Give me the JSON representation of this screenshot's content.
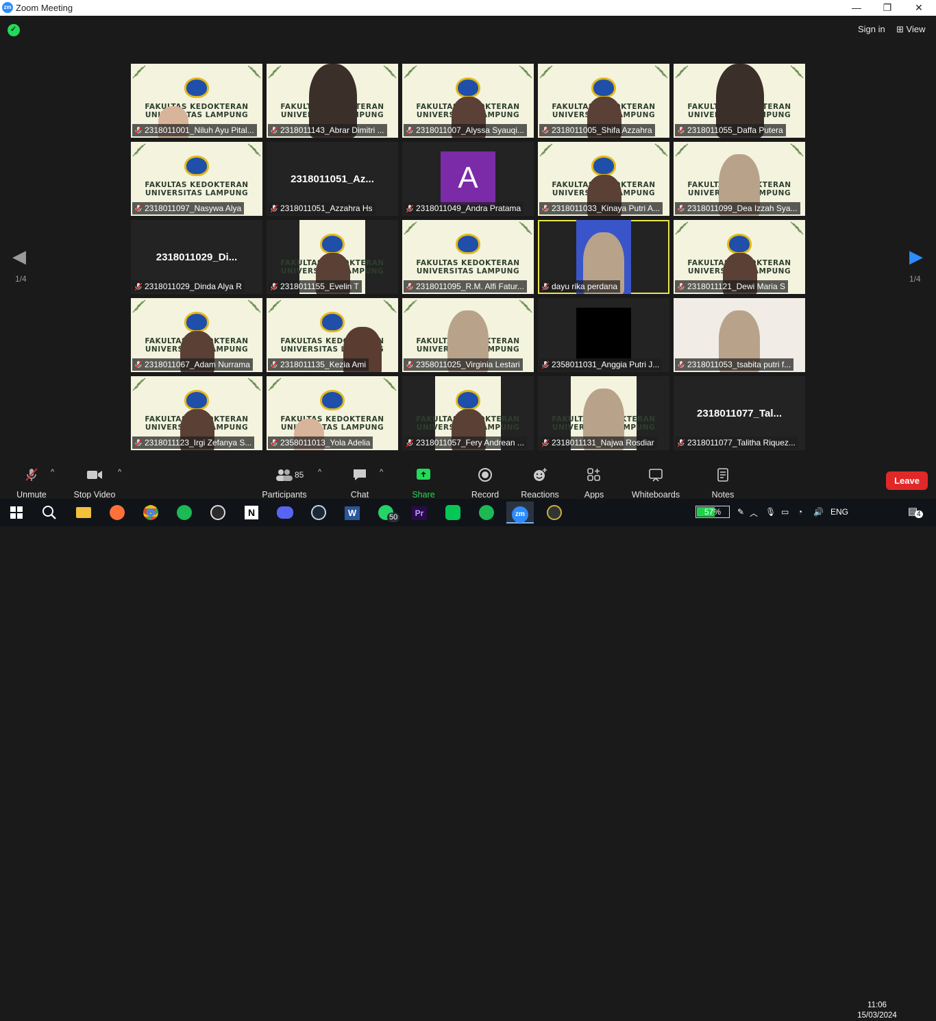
{
  "window": {
    "title": "Zoom Meeting",
    "minimize": "—",
    "restore": "❐",
    "close": "✕"
  },
  "topbar": {
    "sign_in": "Sign in",
    "view": "View",
    "view_icon": "grid-icon"
  },
  "pager": {
    "left": "1/4",
    "right": "1/4"
  },
  "tiles": [
    {
      "name": "2318011001_Niluh Ayu Pital...",
      "kind": "banner",
      "person": "left"
    },
    {
      "name": "2318011143_Abrar Dimitri ...",
      "kind": "banner",
      "person": "center-large"
    },
    {
      "name": "2318011007_Alyssa Syauqi...",
      "kind": "banner",
      "person": "center-small"
    },
    {
      "name": "2318011005_Shifa Azzahra",
      "kind": "banner",
      "person": "center-small"
    },
    {
      "name": "2318011055_Daffa Putera",
      "kind": "banner",
      "person": "center-large"
    },
    {
      "name": "2318011097_Nasywa Alya",
      "kind": "banner",
      "person": "none"
    },
    {
      "name": "2318011051_Azzahra Hs",
      "kind": "name",
      "big": "2318011051_Az..."
    },
    {
      "name": "2318011049_Andra Pratama",
      "kind": "avatar",
      "initial": "A"
    },
    {
      "name": "2318011033_Kinaya Putri A...",
      "kind": "banner",
      "person": "center-small"
    },
    {
      "name": "2318011099_Dea Izzah Sya...",
      "kind": "banner",
      "person": "center-hijab"
    },
    {
      "name": "2318011029_Dinda Alya R",
      "kind": "name",
      "big": "2318011029_Di..."
    },
    {
      "name": "2318011155_Evelin T",
      "kind": "banner-narrow",
      "person": "center-small"
    },
    {
      "name": "2318011095_R.M. Alfi Fatur...",
      "kind": "banner",
      "person": "none"
    },
    {
      "name": "dayu rika perdana",
      "kind": "video-narrow",
      "person": "center-hijab",
      "active": true
    },
    {
      "name": "2318011121_Dewi Maria S",
      "kind": "banner",
      "person": "center-small"
    },
    {
      "name": "2318011067_Adam Nurrama",
      "kind": "banner",
      "person": "center-small"
    },
    {
      "name": "2318011135_Kezia Ami",
      "kind": "banner",
      "person": "right"
    },
    {
      "name": "2358011025_Virginia Lestari",
      "kind": "banner",
      "person": "center-hijab"
    },
    {
      "name": "2358011031_Anggia Putri J...",
      "kind": "black"
    },
    {
      "name": "2318011053_tsabita putri f...",
      "kind": "video",
      "person": "center-hijab"
    },
    {
      "name": "2318011123_Irgi Zefanya S...",
      "kind": "banner",
      "person": "center-small"
    },
    {
      "name": "2358011013_Yola Adelia",
      "kind": "banner",
      "person": "left"
    },
    {
      "name": "2318011057_Fery Andrean ...",
      "kind": "banner-narrow",
      "person": "center-small"
    },
    {
      "name": "2318011131_Najwa Rosdiar",
      "kind": "banner-narrow",
      "person": "center-hijab"
    },
    {
      "name": "2318011077_Talitha Riquez...",
      "kind": "name",
      "big": "2318011077_Tal..."
    }
  ],
  "banner": {
    "line1": "FAKULTAS KEDOKTERAN",
    "line2": "UNIVERSITAS LAMPUNG"
  },
  "toolbar": {
    "unmute": "Unmute",
    "stop_video": "Stop Video",
    "participants": "Participants",
    "participants_count": "85",
    "chat": "Chat",
    "share_screen": "Share Screen",
    "record": "Record",
    "reactions": "Reactions",
    "apps": "Apps",
    "whiteboards": "Whiteboards",
    "notes": "Notes",
    "leave": "Leave"
  },
  "taskbar": {
    "whatsapp_badge": "50",
    "battery": "57%",
    "battery_level": 0.57,
    "lang": "ENG",
    "time": "11:06",
    "date": "15/03/2024",
    "notifications": "4"
  },
  "colors": {
    "accent_green": "#23d959",
    "leave_red": "#e02828",
    "active_border": "#e9e64a",
    "avatar_purple": "#7b2ba7"
  }
}
